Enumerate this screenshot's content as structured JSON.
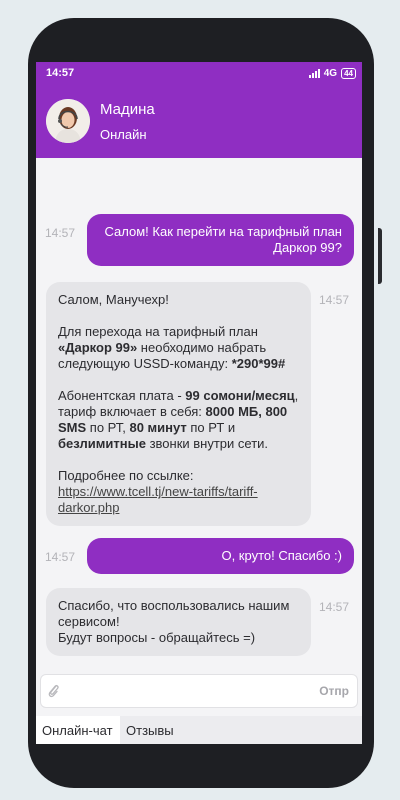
{
  "status_bar": {
    "time": "14:57",
    "network": "4G",
    "battery": "44"
  },
  "header": {
    "contact_name": "Мадина",
    "contact_status": "Онлайн"
  },
  "messages": [
    {
      "time": "14:57",
      "text": "Салом! Как перейти на тарифный план Даркор 99?"
    },
    {
      "time": "14:57",
      "greeting": "Салом, Манучехр!",
      "p2_a": "Для перехода на тарифный план ",
      "p2_b": "«Даркор 99»",
      "p2_c": " необходимо набрать следующую USSD-команду: ",
      "p2_d": "*290*99#",
      "p3_a": "Абонентская плата - ",
      "p3_b": "99 сомони/месяц",
      "p3_c": ", тариф включает в себя: ",
      "p3_d": "8000 МБ, 800 SMS",
      "p3_e": " по РТ, ",
      "p3_f": "80 минут",
      "p3_g": " по РТ и ",
      "p3_h": "безлимитные",
      "p3_i": " звонки внутри сети.",
      "p4": "Подробнее по ссылке:",
      "link": "https://www.tcell.tj/new-tariffs/tariff-darkor.php"
    },
    {
      "time": "14:57",
      "text": "О, круто! Спасибо :)"
    },
    {
      "time": "14:57",
      "line1": "Спасибо, что воспользовались нашим сервисом!",
      "line2": "Будут вопросы - обращайтесь =)"
    }
  ],
  "composer": {
    "placeholder": "",
    "send_label": "Отпр"
  },
  "tabs": [
    {
      "label": "Онлайн-чат",
      "active": true
    },
    {
      "label": "Отзывы",
      "active": false
    }
  ],
  "colors": {
    "accent": "#8f2ec2",
    "incoming_bubble": "#e5e5e8",
    "background": "#e5ecef"
  }
}
